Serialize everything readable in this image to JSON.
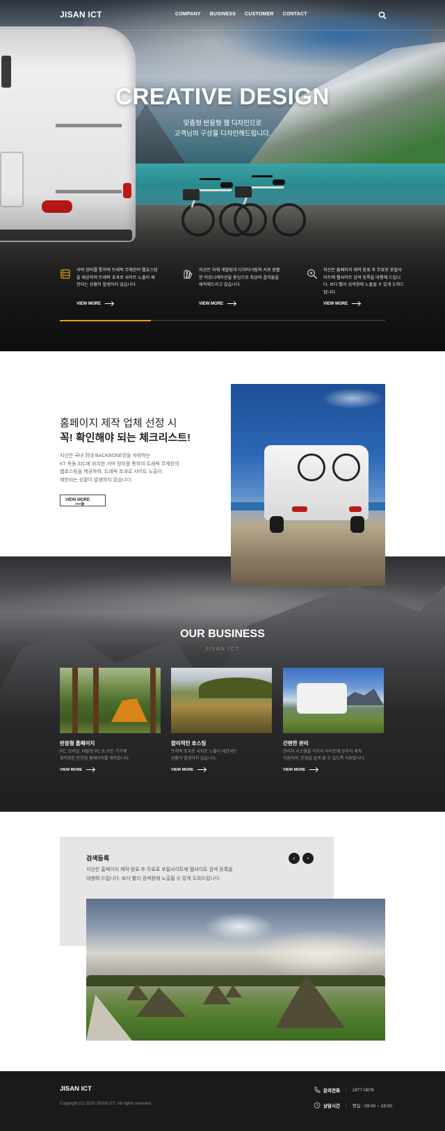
{
  "brand": "JISAN ICT",
  "nav": [
    "COMPANY",
    "BUSINESS",
    "CUSTOMER",
    "CONTACT"
  ],
  "hero": {
    "title": "CREATIVE DESIGN",
    "subtitle_line1": "맞춤형 반응형 웹 디자인으로",
    "subtitle_line2": "고객님의 구상을 디자인해드립니다."
  },
  "features": [
    {
      "icon": "database-icon",
      "text": "서버 장비를 통하여 트래픽 무제한의 웹호스팅을 제공하여 트래픽 초과로 사이트 노출이 제한되는 상황이 발생하지 않습니다.",
      "more": "VIEW MORE"
    },
    {
      "icon": "color-swatch-icon",
      "text": "지산은 자체 개발팀과 디자이너팀의 서로 원활한 커뮤니케이션을 중심으로 최상의 결과물을 제작해드리고 있습니다.",
      "more": "VIEW MORE"
    },
    {
      "icon": "magnifier-plus-icon",
      "text": "지산은 홈페이지 제작 완료 후 무료로 포털사이트에 웹사이트 검색 등록을 대행해 드립니다. 보다 빨리 검색창에 노출될 수 있게 도와드립니다.",
      "more": "VIEW MORE"
    }
  ],
  "slider_progress": 0.28,
  "accent_color": "#e3a21a",
  "checklist": {
    "title_line1": "홈페이지 제작 업체 선정 시",
    "title_line2": "꼭! 확인해야 되는 체크리스트!",
    "body_line1": "지산은 국내 최대 BACKBONE망을 자랑하는",
    "body_line2": "KT 목동 IDC에 위치한 서버 장비를 통하여 트래픽 무제한의",
    "body_line3": "웹호스팅을 제공하여, 트래픽 초과로 사이트 노출이",
    "body_line4": "제한되는 상황이 발생하지 않습니다.",
    "button": "VIEW MORE"
  },
  "business": {
    "title": "OUR BUSINESS",
    "subtitle": "JISAN ICT",
    "cards": [
      {
        "title": "반응형 홈페이지",
        "desc_line1": "PC, 모바일, 태블릿 PC 등 모든 기기에",
        "desc_line2": "최적화된 반응형 홈페이지를 제작합니다.",
        "more": "VIEW MORE"
      },
      {
        "title": "합리적인 호스팅",
        "desc_line1": "트래픽 초과로 사이트 노출이 제한되는",
        "desc_line2": "상황이 발생하지 않습니다.",
        "more": "VIEW MORE"
      },
      {
        "title": "간편한 관리",
        "desc_line1": "관리자 시스템을 각각의 사이트에 맞추어 제작",
        "desc_line2": "지원하여, 운영을 쉽게 할 수 있도록 지원합니다.",
        "more": "VIEW MORE"
      }
    ]
  },
  "search_reg": {
    "title": "검색등록",
    "body_line1": "지산은 홈페이지 제작 완료 후 무료로 포털사이트에 웹사이트 검색 등록을",
    "body_line2": "대행해 드립니다. 보다 빨리 검색창에 노출될 수 있게 도와드립니다.",
    "prev": "‹",
    "next": "›"
  },
  "footer": {
    "brand": "JISAN ICT",
    "copyright": "Copyright (C) 2020 JISAN ICT. All rights reserved.",
    "phone_label": "문의전화",
    "phone": "1877-0876",
    "hours_label": "상담시간",
    "hours": "평일 : 09:00 ~ 18:00"
  }
}
